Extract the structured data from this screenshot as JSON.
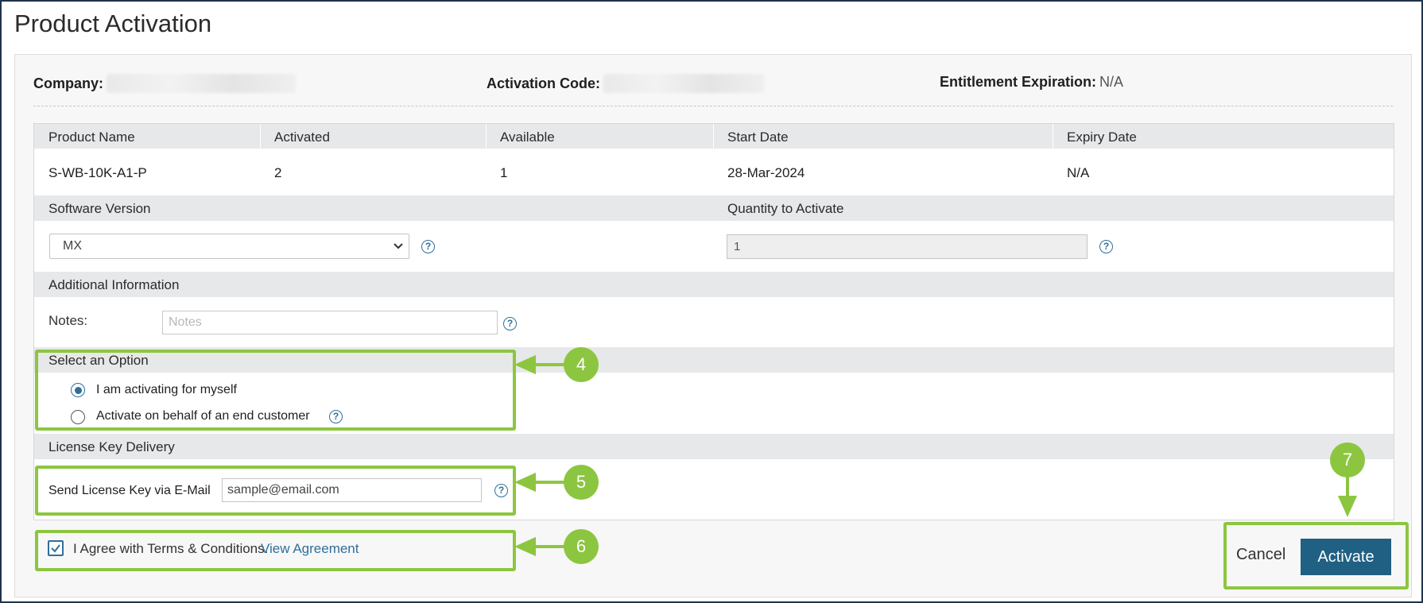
{
  "page": {
    "title": "Product Activation"
  },
  "meta": {
    "company_label": "Company:",
    "activation_code_label": "Activation Code:",
    "entitlement_label": "Entitlement Expiration:",
    "entitlement_value": "N/A"
  },
  "table": {
    "headers": [
      "Product Name",
      "Activated",
      "Available",
      "Start Date",
      "Expiry Date"
    ],
    "row": [
      "S-WB-10K-A1-P",
      "2",
      "1",
      "28-Mar-2024",
      "N/A"
    ]
  },
  "software": {
    "label": "Software Version",
    "selected": "MX",
    "quantity_label": "Quantity to Activate",
    "quantity_value": "1"
  },
  "additional": {
    "label": "Additional Information",
    "notes_label": "Notes:",
    "notes_placeholder": "Notes"
  },
  "option": {
    "label": "Select an Option",
    "choices": [
      "I am activating for myself",
      "Activate on behalf of an end customer"
    ],
    "selected_index": 0
  },
  "delivery": {
    "label": "License Key Delivery",
    "email_label": "Send License Key via E-Mail",
    "email_value": "sample@email.com"
  },
  "terms": {
    "text": "I Agree with Terms & Conditions.",
    "link": "View Agreement",
    "checked": true
  },
  "actions": {
    "cancel": "Cancel",
    "activate": "Activate"
  },
  "annotations": {
    "callout_4": "4",
    "callout_5": "5",
    "callout_6": "6",
    "callout_7": "7"
  },
  "colors": {
    "callout": "#8cc640",
    "primary": "#1f6083",
    "link": "#2f6f9a"
  },
  "icons": {
    "help": "question-circle-icon",
    "dropdown": "chevron-down-icon",
    "check": "check-icon"
  }
}
